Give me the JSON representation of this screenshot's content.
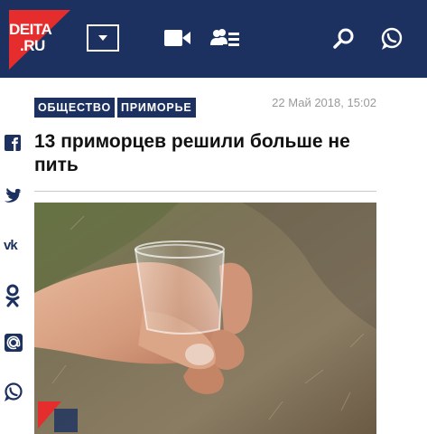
{
  "header": {
    "logo_line1": "DEITA",
    "logo_line2": ".RU",
    "menu_icon": "chevron-down-icon",
    "icons": [
      "video-camera-icon",
      "people-list-icon",
      "search-icon",
      "whatsapp-icon"
    ],
    "bg_color": "#1d3160",
    "accent_color": "#e52d2d"
  },
  "article": {
    "tags": [
      "ОБЩЕСТВО",
      "ПРИМОРЬЕ"
    ],
    "date": "22 Май 2018, 15:02",
    "title": "13 приморцев решили больше не пить",
    "photo_alt_icon": "photo-hand-holding-shot-glass"
  },
  "share": {
    "icons": [
      "facebook-icon",
      "twitter-icon",
      "vk-icon",
      "odnoklassniki-icon",
      "email-icon",
      "whatsapp-icon"
    ]
  }
}
